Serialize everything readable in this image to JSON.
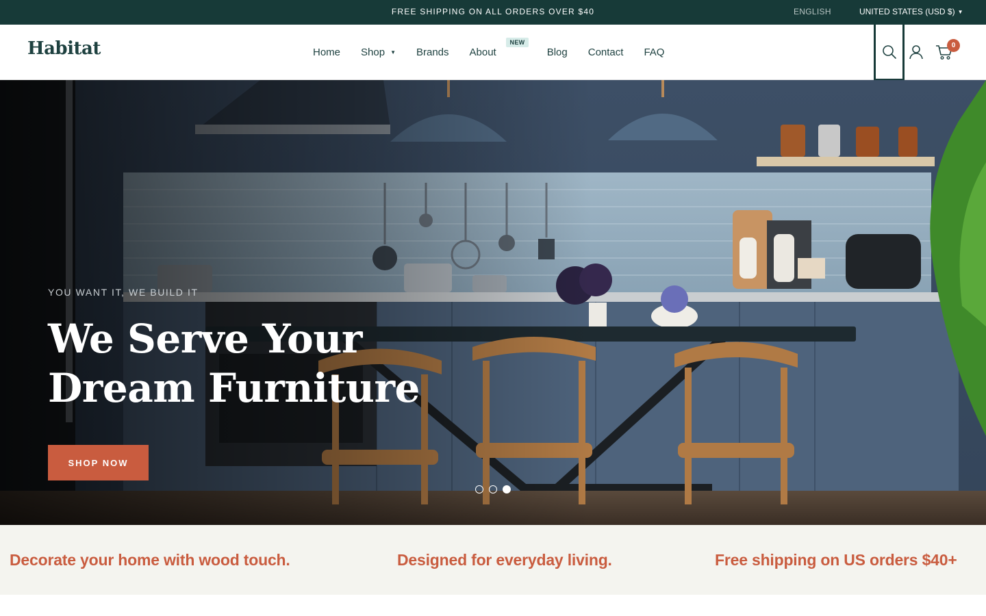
{
  "announcement": {
    "text": "FREE SHIPPING ON ALL ORDERS OVER $40",
    "language": "ENGLISH",
    "country": "UNITED STATES (USD $)"
  },
  "header": {
    "logo": "Habitat",
    "nav": [
      {
        "label": "Home"
      },
      {
        "label": "Shop"
      },
      {
        "label": "Brands"
      },
      {
        "label": "About",
        "badge": "NEW"
      },
      {
        "label": "Blog"
      },
      {
        "label": "Contact"
      },
      {
        "label": "FAQ"
      }
    ],
    "cart_count": "0",
    "icons": [
      "search-icon",
      "account-icon",
      "cart-icon"
    ]
  },
  "hero": {
    "eyebrow": "YOU WANT IT, WE BUILD IT",
    "title_line1": "We Serve Your",
    "title_line2": "Dream Furniture",
    "cta": "SHOP NOW",
    "slides": 3,
    "active_slide": 3
  },
  "features": [
    {
      "text": "Decorate your home with wood touch."
    },
    {
      "text": "Designed for everyday living."
    },
    {
      "text": "Free shipping on US orders $40+"
    }
  ],
  "colors": {
    "brand_dark": "#173a38",
    "accent": "#c95c3f",
    "strip_bg": "#f4f4ef"
  }
}
